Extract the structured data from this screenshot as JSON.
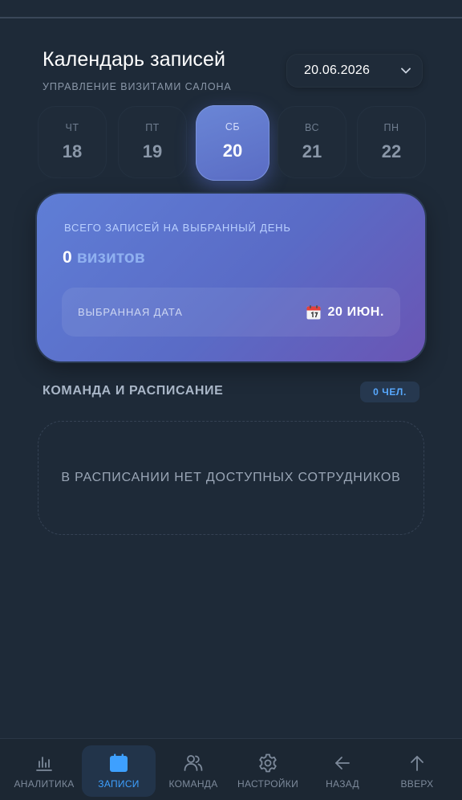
{
  "header": {
    "title": "Календарь записей",
    "subtitle": "УПРАВЛЕНИЕ ВИЗИТАМИ САЛОНА",
    "date_select": "20.06.2026"
  },
  "days": [
    {
      "name": "ЧТ",
      "num": "18",
      "active": false
    },
    {
      "name": "ПТ",
      "num": "19",
      "active": false
    },
    {
      "name": "СБ",
      "num": "20",
      "active": true
    },
    {
      "name": "ВС",
      "num": "21",
      "active": false
    },
    {
      "name": "ПН",
      "num": "22",
      "active": false
    }
  ],
  "summary": {
    "label": "ВСЕГО ЗАПИСЕЙ НА ВЫБРАННЫЙ ДЕНЬ",
    "count": "0",
    "unit": "визитов",
    "date_label": "ВЫБРАННАЯ ДАТА",
    "date_value": "20 ИЮН."
  },
  "team": {
    "heading": "КОМАНДА И РАСПИСАНИЕ",
    "badge": "0 ЧЕЛ.",
    "empty_text": "В РАСПИСАНИИ НЕТ ДОСТУПНЫХ СОТРУДНИКОВ"
  },
  "nav": [
    {
      "label": "АНАЛИТИКА",
      "icon": "bar-chart-icon",
      "active": false
    },
    {
      "label": "ЗАПИСИ",
      "icon": "calendar-icon",
      "active": true
    },
    {
      "label": "КОМАНДА",
      "icon": "users-icon",
      "active": false
    },
    {
      "label": "НАСТРОЙКИ",
      "icon": "gear-icon",
      "active": false
    },
    {
      "label": "НАЗАД",
      "icon": "arrow-left-icon",
      "active": false
    },
    {
      "label": "ВВЕРХ",
      "icon": "arrow-up-icon",
      "active": false
    }
  ],
  "colors": {
    "background": "#1e2a38",
    "accent": "#3ea0ff",
    "card_gradient_start": "#5f7ed6",
    "card_gradient_end": "#6a55b4"
  }
}
